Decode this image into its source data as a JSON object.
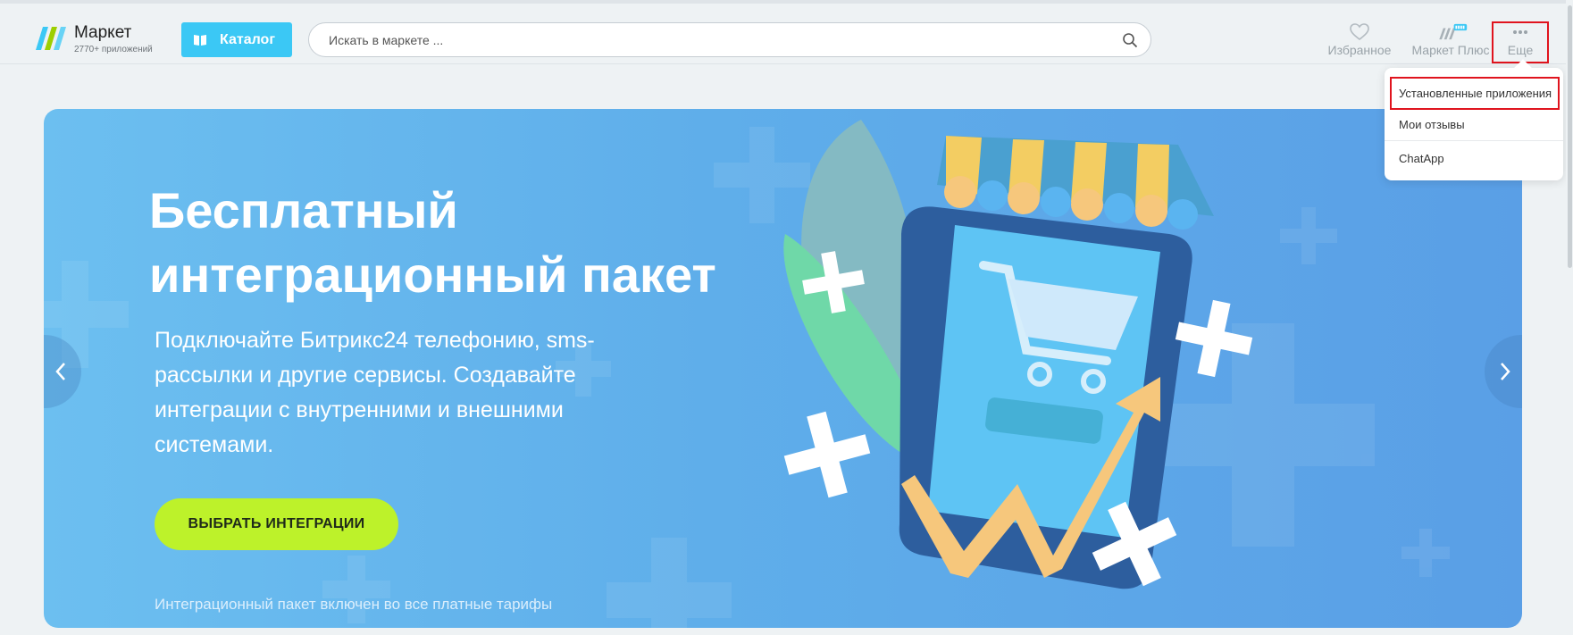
{
  "header": {
    "logo_title": "Маркет",
    "logo_subtitle": "2770+ приложений",
    "catalog_label": "Каталог",
    "search_placeholder": "Искать в маркете ...",
    "favorites_label": "Избранное",
    "market_plus_label": "Маркет Плюс",
    "more_label": "Еще"
  },
  "dropdown": {
    "items": [
      {
        "label": "Установленные приложения"
      },
      {
        "label": "Мои отзывы"
      },
      {
        "label": "ChatApp"
      }
    ]
  },
  "banner": {
    "title_line1": "Бесплатный",
    "title_line2": "интеграционный пакет",
    "description": "Подключайте Битрикс24 телефонию, sms-рассылки и другие сервисы. Создавайте интеграции с внутренними и внешними системами.",
    "cta_label": "ВЫБРАТЬ ИНТЕГРАЦИИ",
    "note": "Интеграционный пакет включен во все платные тарифы"
  },
  "colors": {
    "catalog_button": "#3bc8f5",
    "cta_button": "#bdf22a",
    "highlight_frame": "#e0141e",
    "banner_start": "#6cbff0",
    "banner_end": "#5a9fe6"
  },
  "icons": {
    "catalog": "book-icon",
    "search": "search-icon",
    "favorites": "heart-icon",
    "market_plus": "market-plus-icon",
    "more": "dots-icon",
    "prev": "chevron-left-icon",
    "next": "chevron-right-icon"
  }
}
